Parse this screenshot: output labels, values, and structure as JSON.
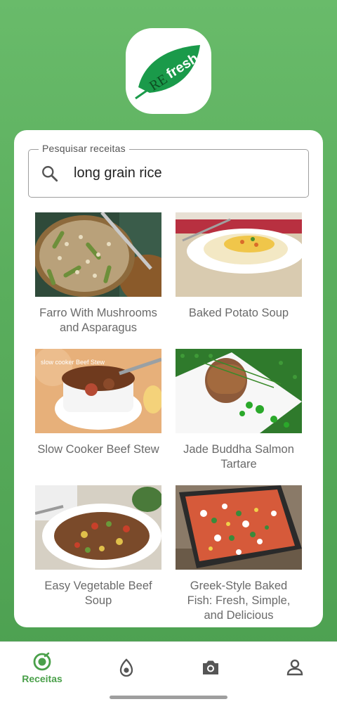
{
  "app": {
    "logo_text_re": "RE",
    "logo_text_fresh": "fresh",
    "accent": "#4aa04a"
  },
  "search": {
    "label": "Pesquisar receitas",
    "value": "long grain rice",
    "icon": "search-icon"
  },
  "recipes": [
    {
      "title": "Farro With Mushrooms and Asparagus"
    },
    {
      "title": "Baked Potato Soup"
    },
    {
      "title": "Slow Cooker Beef Stew"
    },
    {
      "title": "Jade Buddha Salmon Tartare"
    },
    {
      "title": "Easy Vegetable Beef Soup"
    },
    {
      "title": "Greek-Style Baked Fish: Fresh, Simple, and Delicious"
    }
  ],
  "thumb_overlay": {
    "beef_stew_caption": "slow cooker Beef Stew"
  },
  "nav": {
    "items": [
      {
        "label": "Receitas",
        "icon": "recipes-icon",
        "active": true
      },
      {
        "label": "",
        "icon": "avocado-icon",
        "active": false
      },
      {
        "label": "",
        "icon": "camera-icon",
        "active": false
      },
      {
        "label": "",
        "icon": "profile-icon",
        "active": false
      }
    ]
  }
}
